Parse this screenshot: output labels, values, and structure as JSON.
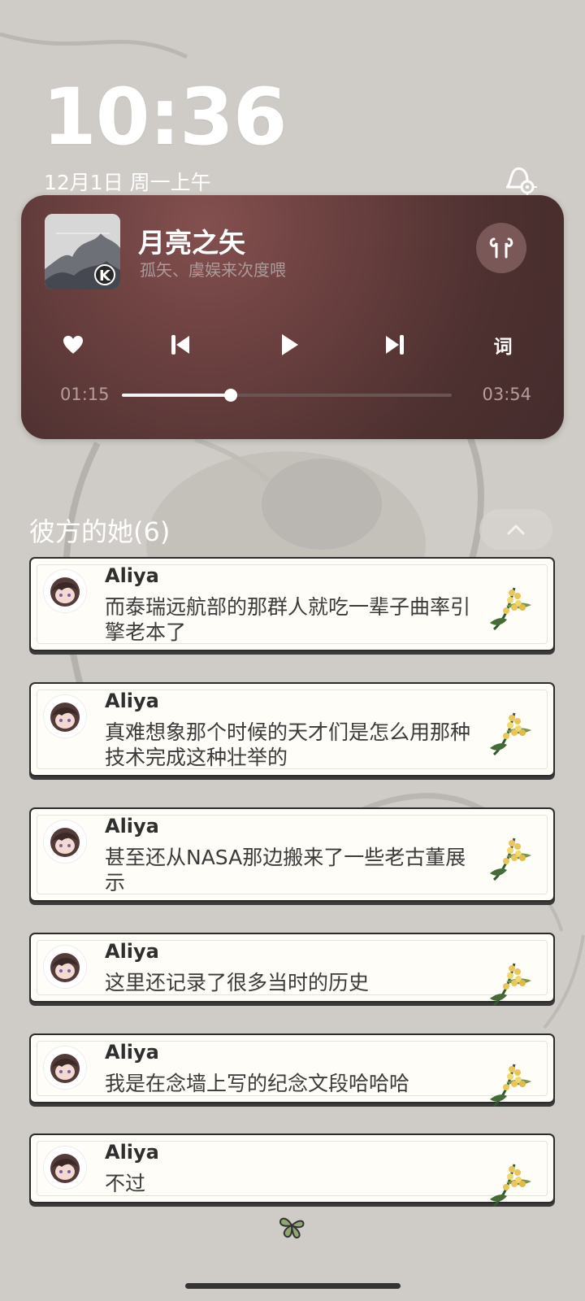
{
  "lockscreen": {
    "time": "10:36",
    "date": "12月1日 周一上午",
    "alarm_icon": "alarm-settings-icon"
  },
  "music": {
    "title": "月亮之矢",
    "artist": "孤矢、虞娱来次度喂",
    "album_badge": "K",
    "controls": {
      "like": "heart-icon",
      "previous": "previous-track-icon",
      "play": "play-icon",
      "next": "next-track-icon",
      "lyrics": "词"
    },
    "elapsed": "01:15",
    "duration": "03:54",
    "progress": 0.33
  },
  "notifications": {
    "group_title": "彼方的她(6)",
    "collapse_icon": "chevron-up-icon",
    "items": [
      {
        "sender": "Aliya",
        "message": "而泰瑞远航部的那群人就吃一辈子曲率引擎老本了"
      },
      {
        "sender": "Aliya",
        "message": "真难想象那个时候的天才们是怎么用那种技术完成这种壮举的"
      },
      {
        "sender": "Aliya",
        "message": "甚至还从NASA那边搬来了一些老古董展示"
      },
      {
        "sender": "Aliya",
        "message": "这里还记录了很多当时的历史"
      },
      {
        "sender": "Aliya",
        "message": "我是在念墙上写的纪念文段哈哈哈"
      },
      {
        "sender": "Aliya",
        "message": "不过"
      }
    ]
  },
  "colors": {
    "player_background": "#5b3837",
    "card_background": "#fffdf7",
    "card_border": "#2d2c2c"
  }
}
